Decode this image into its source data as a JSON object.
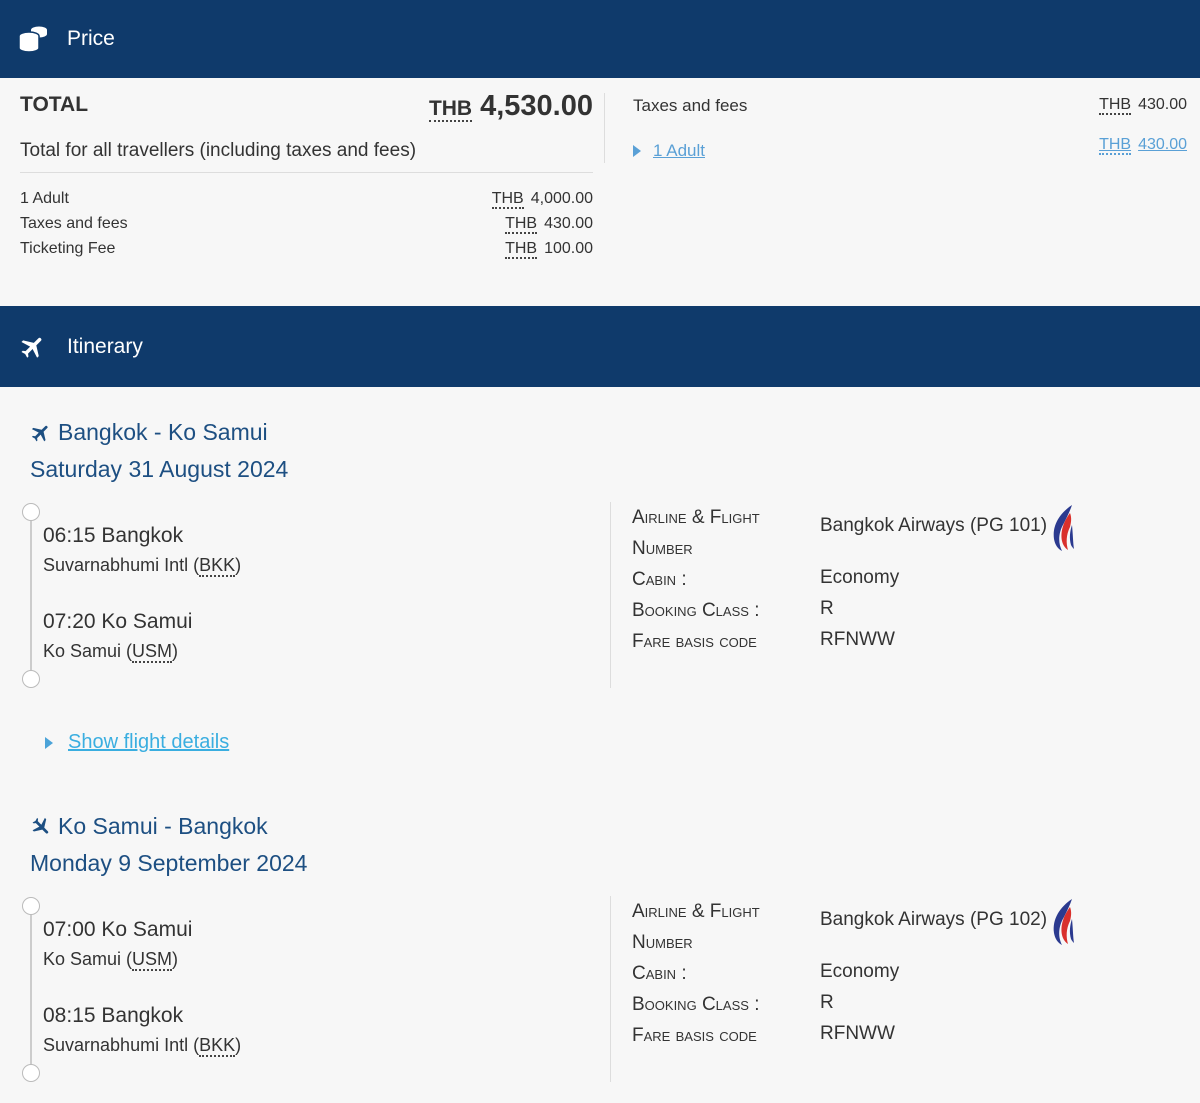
{
  "price": {
    "title": "Price",
    "total_label": "TOTAL",
    "currency": "THB",
    "total_amount": "4,530.00",
    "total_sub": "Total for all travellers (including taxes and fees)",
    "breakdown": [
      {
        "label": "1 Adult",
        "currency": "THB",
        "amount": "4,000.00"
      },
      {
        "label": "Taxes and fees",
        "currency": "THB",
        "amount": "430.00"
      },
      {
        "label": "Ticketing Fee",
        "currency": "THB",
        "amount": "100.00"
      }
    ],
    "taxes": {
      "label": "Taxes and fees",
      "currency": "THB",
      "amount": "430.00",
      "adult_link": "1 Adult",
      "adult_currency": "THB",
      "adult_amount": "430.00"
    }
  },
  "itinerary": {
    "title": "Itinerary",
    "show_details": "Show flight details",
    "segments": [
      {
        "route": "Bangkok - Ko Samui",
        "date": "Saturday 31 August 2024",
        "dep_time": "06:15 Bangkok",
        "dep_airport": "Suvarnabhumi Intl",
        "dep_code": "BKK",
        "arr_time": "07:20 Ko Samui",
        "arr_airport": "Ko Samui",
        "arr_code": "USM",
        "labels": {
          "airline_1": "Airline & Flight",
          "airline_2": "Number",
          "cabin": "Cabin :",
          "booking": "Booking Class :",
          "fare": "Fare basis code"
        },
        "airline": "Bangkok Airways (PG 101)",
        "cabin": "Economy",
        "booking_class": "R",
        "fare_basis": "RFNWW"
      },
      {
        "route": "Ko Samui - Bangkok",
        "date": "Monday 9 September 2024",
        "dep_time": "07:00 Ko Samui",
        "dep_airport": "Ko Samui",
        "dep_code": "USM",
        "arr_time": "08:15 Bangkok",
        "arr_airport": "Suvarnabhumi Intl",
        "arr_code": "BKK",
        "labels": {
          "airline_1": "Airline & Flight",
          "airline_2": "Number",
          "cabin": "Cabin :",
          "booking": "Booking Class :",
          "fare": "Fare basis code"
        },
        "airline": "Bangkok Airways (PG 102)",
        "cabin": "Economy",
        "booking_class": "R",
        "fare_basis": "RFNWW"
      }
    ]
  },
  "colors": {
    "header_bg": "#0f3a6b",
    "route_text": "#1d4f82",
    "link": "#5aa0d6",
    "show_details": "#3aaee0"
  }
}
